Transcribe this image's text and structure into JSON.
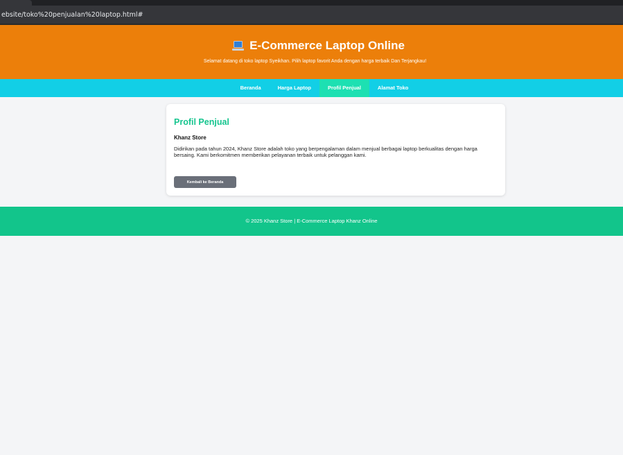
{
  "browser": {
    "url": "ebsite/toko%20penjualan%20laptop.html#"
  },
  "header": {
    "icon": "laptop-icon",
    "title": "E-Commerce Laptop Online",
    "subtitle": "Selamat datang di toko laptop Syeikhan. Pilih laptop favorit Anda dengan harga terbaik Dan Terjangkau!"
  },
  "nav": {
    "items": [
      {
        "label": "Beranda"
      },
      {
        "label": "Harga Laptop"
      },
      {
        "label": "Profil Penjual",
        "active": true
      },
      {
        "label": "Alamat Toko"
      }
    ]
  },
  "profile": {
    "title": "Profil Penjual",
    "store_name": "Khanz Store",
    "description": "Didirikan pada tahun 2024, Khanz Store adalah toko yang berpengalaman dalam menjual berbagai laptop berkualitas dengan harga bersaing. Kami berkomitmen memberikan pelayanan terbaik untuk pelanggan kami.",
    "back_button": "Kembali ke Beranda"
  },
  "footer": {
    "text": "© 2025 Khanz Store | E-Commerce Laptop Khanz Online"
  },
  "colors": {
    "header": "#ec7f0a",
    "nav": "#12cfe6",
    "nav_active": "#1de0b2",
    "accent": "#17c58f",
    "footer": "#12c58b"
  }
}
